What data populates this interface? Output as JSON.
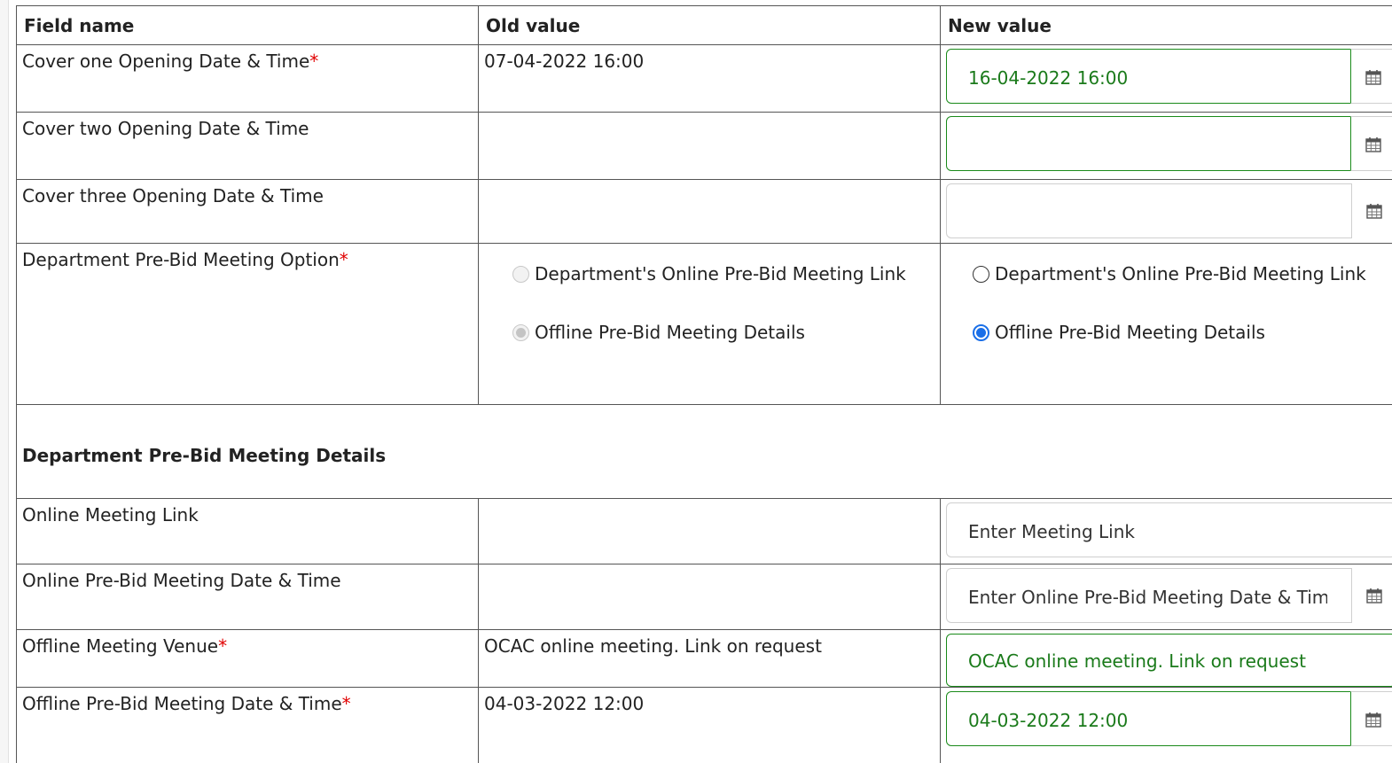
{
  "table": {
    "headers": {
      "field": "Field name",
      "old": "Old value",
      "new": "New value"
    },
    "rows": {
      "cover1": {
        "label": "Cover one Opening Date & Time",
        "required": "*",
        "old": "07-04-2022 16:00",
        "new": "16-04-2022 16:00"
      },
      "cover2": {
        "label": "Cover two Opening Date & Time",
        "old": "",
        "new": ""
      },
      "cover3": {
        "label": "Cover three Opening Date & Time",
        "old": "",
        "new": ""
      },
      "prebid_option": {
        "label": "Department Pre-Bid Meeting Option",
        "required": "*",
        "options": [
          "Department's Online Pre-Bid Meeting Link",
          "Offline Pre-Bid Meeting Details"
        ],
        "old_selected": "Offline Pre-Bid Meeting Details",
        "new_selected": "Offline Pre-Bid Meeting Details"
      },
      "section": {
        "title": "Department Pre-Bid Meeting Details"
      },
      "online_link": {
        "label": "Online Meeting Link",
        "old": "",
        "placeholder": "Enter Meeting Link"
      },
      "online_datetime": {
        "label": "Online Pre-Bid Meeting Date & Time",
        "old": "",
        "placeholder": "Enter Online Pre-Bid Meeting Date & Time"
      },
      "offline_venue": {
        "label": "Offline Meeting Venue",
        "required": "*",
        "old": "OCAC online meeting. Link on request",
        "new": "OCAC online meeting. Link on request"
      },
      "offline_datetime": {
        "label": "Offline Pre-Bid Meeting Date & Time",
        "required": "*",
        "old": "04-03-2022 12:00",
        "new": "04-03-2022 12:00"
      }
    }
  },
  "icons": {
    "calendar": "calendar-icon"
  },
  "colors": {
    "required": "#e00000",
    "valid_border": "#1a8a1a",
    "radio_selected": "#1a6fe8"
  }
}
